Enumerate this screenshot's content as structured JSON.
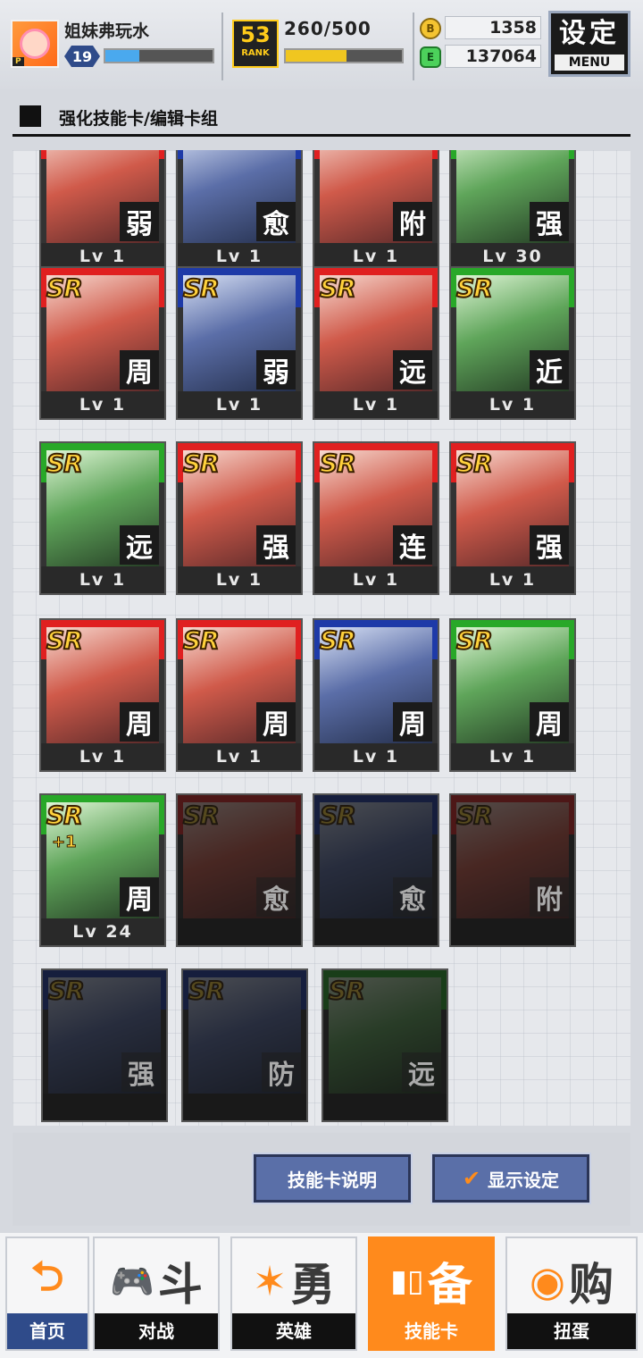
{
  "header": {
    "player_name": "姐妹弗玩水",
    "player_level": "19",
    "exp_fraction": 0.32,
    "rank_icon_num": "53",
    "rank_icon_label": "RANK",
    "rank_points": "260/500",
    "rank_fraction": 0.52,
    "coins": "1358",
    "gems": "137064",
    "coin_icon_glyph": "B",
    "gem_icon_glyph": "E",
    "menu_zh": "设定",
    "menu_en": "MENU"
  },
  "section": {
    "title": "强化技能卡/编辑卡组"
  },
  "cards": [
    {
      "rarity": "",
      "type": "弱",
      "lv": "Lv 1",
      "color": "red",
      "locked": false
    },
    {
      "rarity": "",
      "type": "愈",
      "lv": "Lv 1",
      "color": "blue",
      "locked": false
    },
    {
      "rarity": "",
      "type": "附",
      "lv": "Lv 1",
      "color": "red",
      "locked": false
    },
    {
      "rarity": "",
      "type": "强",
      "lv": "Lv 30",
      "color": "green",
      "locked": false
    },
    {
      "rarity": "SR",
      "type": "周",
      "lv": "Lv 1",
      "color": "red",
      "locked": false
    },
    {
      "rarity": "SR",
      "type": "弱",
      "lv": "Lv 1",
      "color": "blue",
      "locked": false
    },
    {
      "rarity": "SR",
      "type": "远",
      "lv": "Lv 1",
      "color": "red",
      "locked": false
    },
    {
      "rarity": "SR",
      "type": "近",
      "lv": "Lv 1",
      "color": "green",
      "locked": false
    },
    {
      "rarity": "SR",
      "type": "远",
      "lv": "Lv 1",
      "color": "green",
      "locked": false
    },
    {
      "rarity": "SR",
      "type": "强",
      "lv": "Lv 1",
      "color": "red",
      "locked": false
    },
    {
      "rarity": "SR",
      "type": "连",
      "lv": "Lv 1",
      "color": "red",
      "locked": false
    },
    {
      "rarity": "SR",
      "type": "强",
      "lv": "Lv 1",
      "color": "red",
      "locked": false
    },
    {
      "rarity": "SR",
      "type": "周",
      "lv": "Lv 1",
      "color": "red",
      "locked": false
    },
    {
      "rarity": "SR",
      "type": "周",
      "lv": "Lv 1",
      "color": "red",
      "locked": false
    },
    {
      "rarity": "SR",
      "type": "周",
      "lv": "Lv 1",
      "color": "blue",
      "locked": false
    },
    {
      "rarity": "SR",
      "type": "周",
      "lv": "Lv 1",
      "color": "green",
      "locked": false
    },
    {
      "rarity": "SR",
      "plus": "+1",
      "type": "周",
      "lv": "Lv 24",
      "color": "green",
      "locked": false
    },
    {
      "rarity": "SR",
      "type": "愈",
      "lv": "",
      "color": "red",
      "locked": true
    },
    {
      "rarity": "SR",
      "type": "愈",
      "lv": "",
      "color": "blue",
      "locked": true
    },
    {
      "rarity": "SR",
      "type": "附",
      "lv": "",
      "color": "red",
      "locked": true
    },
    {
      "rarity": "SR",
      "type": "强",
      "lv": "",
      "color": "blue",
      "locked": true
    },
    {
      "rarity": "SR",
      "type": "防",
      "lv": "",
      "color": "blue",
      "locked": true
    },
    {
      "rarity": "SR",
      "type": "远",
      "lv": "",
      "color": "green",
      "locked": true
    }
  ],
  "actions": {
    "card_help": "技能卡说明",
    "display_settings": "显示设定",
    "check_icon": "✔"
  },
  "nav": [
    {
      "glyph": "⮌",
      "big": "",
      "label": "首页"
    },
    {
      "glyph": "🎮",
      "big": "斗",
      "label": "对战"
    },
    {
      "glyph": "✶",
      "big": "勇",
      "label": "英雄"
    },
    {
      "glyph": "▮▯",
      "big": "备",
      "label": "技能卡"
    },
    {
      "glyph": "◉",
      "big": "购",
      "label": "扭蛋"
    }
  ]
}
